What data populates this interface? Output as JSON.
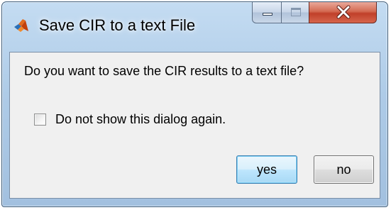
{
  "window": {
    "title": "Save CIR to a text File",
    "caption_buttons": [
      "minimize",
      "maximize",
      "close"
    ]
  },
  "dialog": {
    "question": "Do you want to save the CIR results to a text file?",
    "checkbox": {
      "label": "Do not show this dialog again.",
      "checked": false
    },
    "buttons": {
      "yes_label": "yes",
      "no_label": "no"
    }
  },
  "icons": {
    "app": "matlab-icon",
    "minimize": "minimize-icon",
    "maximize": "maximize-icon",
    "close": "close-icon"
  },
  "colors": {
    "close_button": "#c0402a",
    "default_button_border": "#3c7fb1",
    "client_background": "#f0f0f0"
  }
}
